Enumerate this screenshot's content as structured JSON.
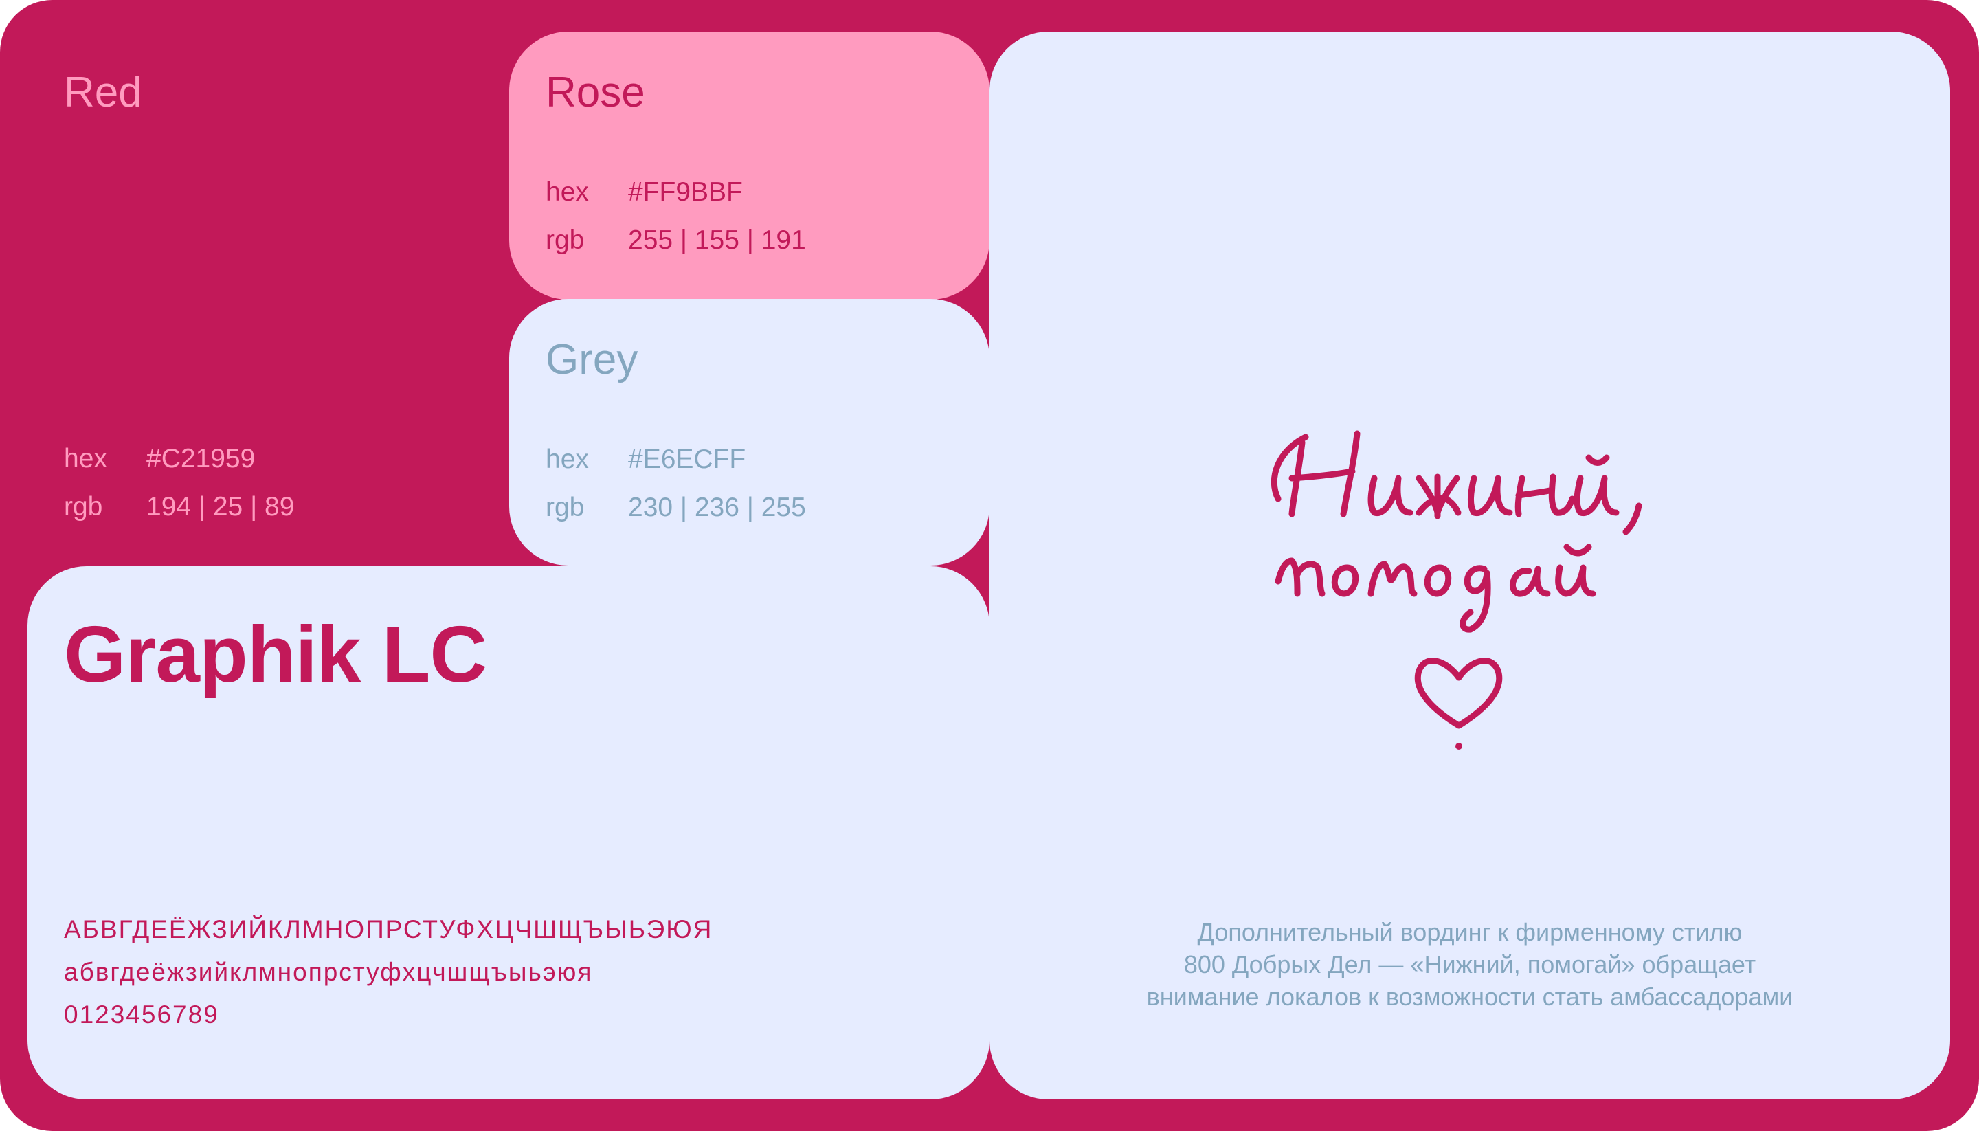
{
  "palette": {
    "red": {
      "name": "Red",
      "hex_label": "hex",
      "hex": "#C21959",
      "rgb_label": "rgb",
      "rgb": "194 | 25 | 89"
    },
    "rose": {
      "name": "Rose",
      "hex_label": "hex",
      "hex": "#FF9BBF",
      "rgb_label": "rgb",
      "rgb": "255 | 155 | 191"
    },
    "grey": {
      "name": "Grey",
      "hex_label": "hex",
      "hex": "#E6ECFF",
      "rgb_label": "rgb",
      "rgb": "230 | 236 | 255"
    }
  },
  "typography": {
    "font_name": "Graphik LC",
    "uppercase": "АБВГДЕЁЖЗИЙКЛМНОПРСТУФХЦЧШЩЪЫЬЭЮЯ",
    "lowercase": "абвгдеёжзийклмнопрстуфхцчшщъыьэюя",
    "digits": "0123456789"
  },
  "slogan": {
    "handwritten": "Нижний, помогай",
    "icon": "heart-icon",
    "description": [
      "Дополнительный вординг к фирменному стилю",
      "800 Добрых Дел — «Нижний, помогай» обращает",
      "внимание локалов к возможности стать амбассадорами"
    ]
  },
  "colors": {
    "red": "#C21959",
    "rose": "#FF9BBF",
    "grey": "#E6ECFF",
    "muted_text": "#84A6BF"
  }
}
